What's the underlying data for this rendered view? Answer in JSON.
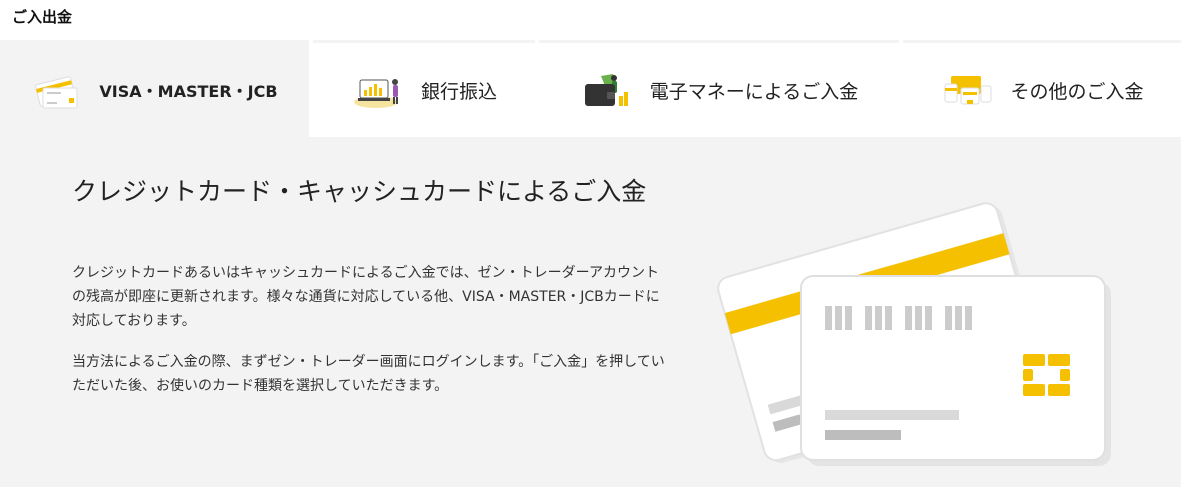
{
  "header": {
    "title": "ご入出金"
  },
  "tabs": [
    {
      "label": "VISA・MASTER・JCB",
      "icon": "credit-card-icon",
      "active": true
    },
    {
      "label": "銀行振込",
      "icon": "bank-transfer-icon",
      "active": false
    },
    {
      "label": "電子マネーによるご入金",
      "icon": "e-money-icon",
      "active": false
    },
    {
      "label": "その他のご入金",
      "icon": "other-payment-icon",
      "active": false
    }
  ],
  "content": {
    "heading": "クレジットカード・キャッシュカードによるご入金",
    "paragraphs": [
      "クレジットカードあるいはキャッシュカードによるご入金では、ゼン・トレーダーアカウントの残高が即座に更新されます。様々な通貨に対応している他、VISA・MASTER・JCBカードに対応しております。",
      "当方法によるご入金の際、まずゼン・トレーダー画面にログインします。「ご入金」を押していただいた後、お使いのカード種類を選択していただきます。"
    ],
    "illustration": "credit-cards-illustration"
  },
  "colors": {
    "accent": "#f5c000",
    "background": "#f2f3f2",
    "card": "#ffffff"
  }
}
